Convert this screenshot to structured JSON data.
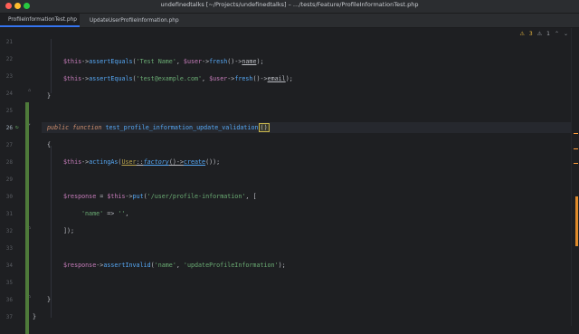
{
  "window": {
    "title": "undefinedtalks [~/Projects/undefinedtalks] – …/tests/Feature/ProfileInformationTest.php"
  },
  "tabs": [
    {
      "label": "ProfileInformationTest.php",
      "active": true
    },
    {
      "label": "UpdateUserProfileInformation.php",
      "active": false
    }
  ],
  "inspections": {
    "warnings": "3",
    "weak_warnings": "1"
  },
  "lines": [
    {
      "n": "21"
    },
    {
      "n": "22"
    },
    {
      "n": "23"
    },
    {
      "n": "24"
    },
    {
      "n": "25"
    },
    {
      "n": "26"
    },
    {
      "n": "27"
    },
    {
      "n": "28"
    },
    {
      "n": "29"
    },
    {
      "n": "30"
    },
    {
      "n": "31"
    },
    {
      "n": "32"
    },
    {
      "n": "33"
    },
    {
      "n": "34"
    },
    {
      "n": "35"
    },
    {
      "n": "36"
    },
    {
      "n": "37"
    }
  ],
  "code": {
    "l22": {
      "a": "$this",
      "b": "->",
      "c": "assertEquals",
      "d": "(",
      "e": "'Test Name'",
      "f": ", ",
      "g": "$user",
      "h": "->",
      "i": "fresh",
      "j": "()->",
      "k": "name",
      "l": ");"
    },
    "l23": {
      "a": "$this",
      "b": "->",
      "c": "assertEquals",
      "d": "(",
      "e": "'test@example.com'",
      "f": ", ",
      "g": "$user",
      "h": "->",
      "i": "fresh",
      "j": "()->",
      "k": "email",
      "l": ");"
    },
    "l24": "}",
    "l26": {
      "a": "public ",
      "b": "function ",
      "c": "test_profile_information_update_validation",
      "d": "()"
    },
    "l27": "{",
    "l28": {
      "a": "$this",
      "b": "->",
      "c": "actingAs",
      "d": "(",
      "e": "User",
      "f": "::",
      "g": "factory",
      "h": "()->",
      "i": "create",
      "j": "());"
    },
    "l30": {
      "a": "$response",
      "b": " = ",
      "c": "$this",
      "d": "->",
      "e": "put",
      "f": "(",
      "g": "'/user/profile-information'",
      "h": ", ["
    },
    "l31": {
      "a": "'name'",
      "b": " => ",
      "c": "''",
      "d": ","
    },
    "l32": "]);",
    "l34": {
      "a": "$response",
      "b": "->",
      "c": "assertInvalid",
      "d": "(",
      "e": "'name'",
      "f": ", ",
      "g": "'updateProfileInformation'",
      "h": ");"
    },
    "l36": "}",
    "l37": "}"
  },
  "colors": {
    "accent": "#3574f0",
    "changed": "#4e7a3a",
    "warning": "#e8b740"
  }
}
